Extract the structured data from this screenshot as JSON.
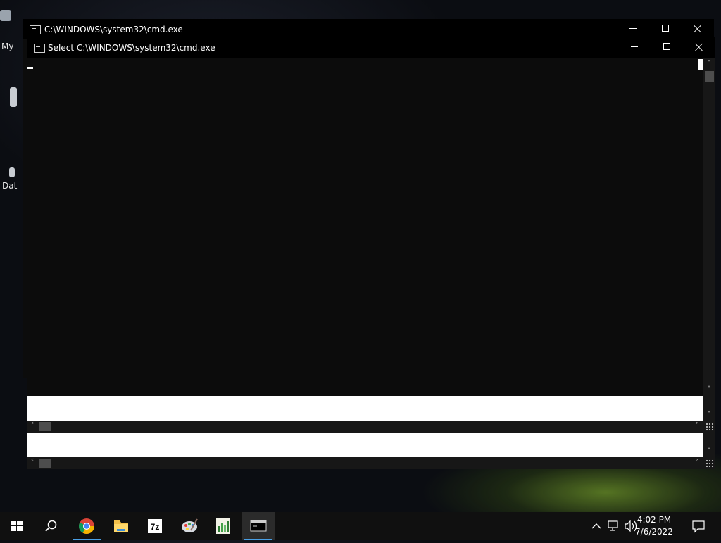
{
  "desktop": {
    "icon_labels": [
      "My",
      "Dat"
    ]
  },
  "back_window": {
    "title": "C:\\WINDOWS\\system32\\cmd.exe",
    "icon": "cmd-icon"
  },
  "front_window": {
    "title": "Select C:\\WINDOWS\\system32\\cmd.exe",
    "icon": "cmd-icon",
    "background": "#0c0c0c"
  },
  "taskbar": {
    "items": [
      "start-icon",
      "search-icon",
      "chrome-icon",
      "file-explorer-icon",
      "7zip-icon",
      "paint-icon",
      "chart-app-icon",
      "cmd-icon"
    ],
    "active_item": "cmd-icon",
    "tray_icons": [
      "chevron-up-icon",
      "network-icon",
      "volume-icon",
      "notification-icon"
    ],
    "clock": {
      "time": "4:02 PM",
      "date": "7/6/2022"
    }
  },
  "colors": {
    "accent": "#4aa0e6",
    "taskbar": "#101010"
  }
}
